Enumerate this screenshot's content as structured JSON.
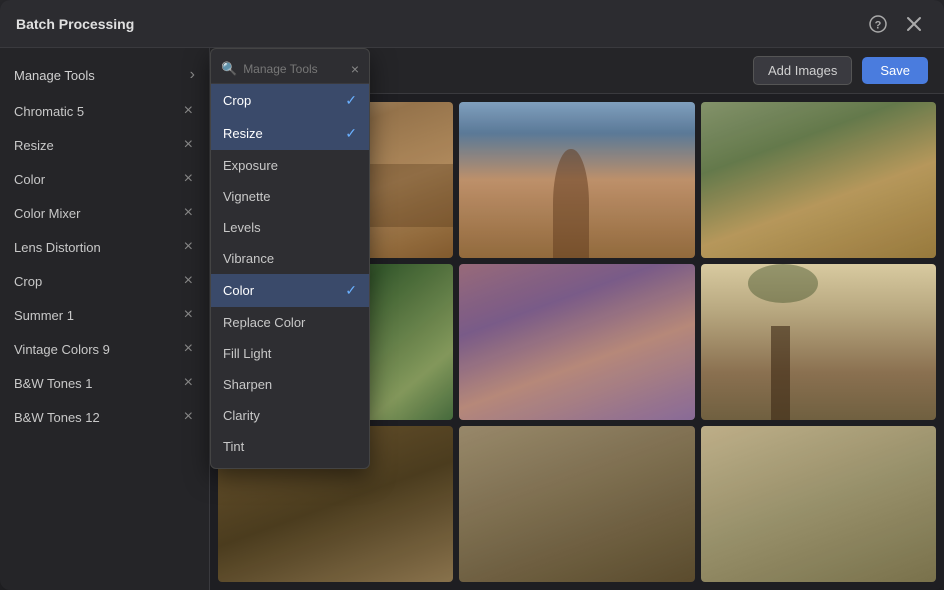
{
  "modal": {
    "title": "Batch Processing",
    "help_icon": "?",
    "close_icon": "×"
  },
  "toolbar": {
    "add_images_label": "Add Images",
    "save_label": "Save"
  },
  "sidebar": {
    "manage_tools_label": "Manage Tools",
    "items": [
      {
        "id": "chromatic5",
        "label": "Chromatic 5",
        "removable": true
      },
      {
        "id": "resize",
        "label": "Resize",
        "removable": true
      },
      {
        "id": "color",
        "label": "Color",
        "removable": true
      },
      {
        "id": "color-mixer",
        "label": "Color Mixer",
        "removable": true
      },
      {
        "id": "lens-distortion",
        "label": "Lens Distortion",
        "removable": true
      },
      {
        "id": "crop",
        "label": "Crop",
        "removable": true
      },
      {
        "id": "summer1",
        "label": "Summer 1",
        "removable": true
      },
      {
        "id": "vintage-colors9",
        "label": "Vintage Colors 9",
        "removable": true
      },
      {
        "id": "bw-tones1",
        "label": "B&W Tones 1",
        "removable": true
      },
      {
        "id": "bw-tones12",
        "label": "B&W Tones 12",
        "removable": true
      }
    ]
  },
  "dropdown": {
    "search_placeholder": "Manage Tools",
    "items": [
      {
        "id": "crop",
        "label": "Crop",
        "selected": true
      },
      {
        "id": "resize",
        "label": "Resize",
        "selected": true
      },
      {
        "id": "exposure",
        "label": "Exposure",
        "selected": false
      },
      {
        "id": "vignette",
        "label": "Vignette",
        "selected": false
      },
      {
        "id": "levels",
        "label": "Levels",
        "selected": false
      },
      {
        "id": "vibrance",
        "label": "Vibrance",
        "selected": false
      },
      {
        "id": "color",
        "label": "Color",
        "selected": true
      },
      {
        "id": "replace-color",
        "label": "Replace Color",
        "selected": false
      },
      {
        "id": "fill-light",
        "label": "Fill Light",
        "selected": false
      },
      {
        "id": "sharpen",
        "label": "Sharpen",
        "selected": false
      },
      {
        "id": "clarity",
        "label": "Clarity",
        "selected": false
      },
      {
        "id": "tint",
        "label": "Tint",
        "selected": false
      }
    ]
  },
  "images": [
    {
      "id": "img1",
      "css_class": "img-desert-wide"
    },
    {
      "id": "img2",
      "css_class": "img-woman-desert"
    },
    {
      "id": "img3",
      "css_class": "img-woman-cactus"
    },
    {
      "id": "img4",
      "css_class": "img-cactus-close"
    },
    {
      "id": "img5",
      "css_class": "img-cactus-pink"
    },
    {
      "id": "img6",
      "css_class": "img-joshua-tree"
    },
    {
      "id": "img7",
      "css_class": "img-bottom-left"
    },
    {
      "id": "img8",
      "css_class": "img-bottom-mid"
    },
    {
      "id": "img9",
      "css_class": "img-bottom-right"
    }
  ],
  "colors": {
    "selected_bg": "#3a4a6a",
    "check_color": "#6ab0ff"
  }
}
